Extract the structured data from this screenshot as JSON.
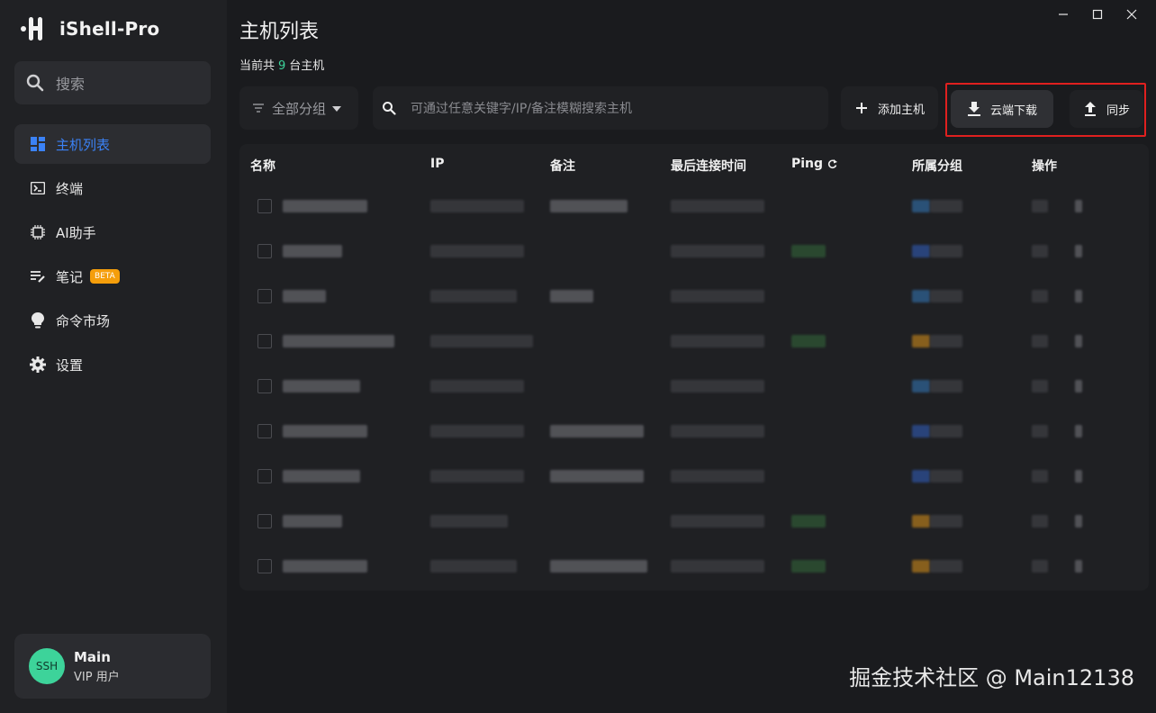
{
  "app": {
    "name": "iShell-Pro"
  },
  "sidebar": {
    "search_label": "搜索",
    "items": [
      {
        "label": "主机列表",
        "icon": "dashboard-icon",
        "active": true
      },
      {
        "label": "终端",
        "icon": "terminal-icon"
      },
      {
        "label": "AI助手",
        "icon": "ai-chip-icon"
      },
      {
        "label": "笔记",
        "icon": "note-icon",
        "badge": "BETA"
      },
      {
        "label": "命令市场",
        "icon": "lightbulb-icon"
      },
      {
        "label": "设置",
        "icon": "gear-icon"
      }
    ],
    "user": {
      "avatar_text": "SSH",
      "name": "Main",
      "role": "VIP 用户"
    }
  },
  "main": {
    "title": "主机列表",
    "count_prefix": "当前共",
    "count": "9",
    "count_suffix": "台主机",
    "group_select": "全部分组",
    "search_placeholder": "可通过任意关键字/IP/备注模糊搜索主机",
    "buttons": {
      "add": "添加主机",
      "download": "云端下载",
      "sync": "同步"
    },
    "table": {
      "columns": [
        "名称",
        "IP",
        "备注",
        "最后连接时间",
        "Ping",
        "所属分组",
        "操作"
      ]
    }
  },
  "watermark": "掘金技术社区 @ Main12138",
  "colors": {
    "accent": "#3b82f6",
    "green": "#3dd39a",
    "highlight": "#e0201f",
    "beta": "#f59e0b"
  }
}
